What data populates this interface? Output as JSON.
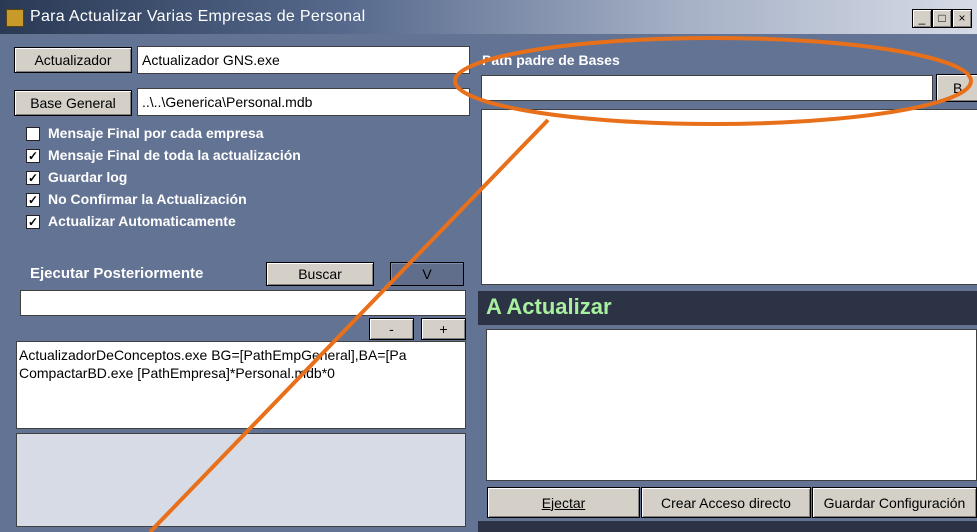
{
  "window": {
    "title": "Para Actualizar Varias Empresas de Personal",
    "buttons": {
      "minimize": "_",
      "maximize": "□",
      "close": "×"
    }
  },
  "left": {
    "actualizador_label": "Actualizador",
    "actualizador_value": "Actualizador GNS.exe",
    "base_general_label": "Base General",
    "base_general_value": "..\\..\\Generica\\Personal.mdb",
    "checkboxes": [
      {
        "label": "Mensaje Final por cada empresa",
        "checked": false,
        "mark": ""
      },
      {
        "label": "Mensaje Final de toda la actualización",
        "checked": true,
        "mark": "✓"
      },
      {
        "label": "Guardar log",
        "checked": true,
        "mark": "✓"
      },
      {
        "label": "No Confirmar la Actualización",
        "checked": true,
        "mark": "✓"
      },
      {
        "label": "Actualizar Automaticamente",
        "checked": true,
        "mark": "✓"
      }
    ],
    "ejecutar_label": "Ejecutar Posteriormente",
    "buscar_label": "Buscar",
    "v_label": "V",
    "ejecutar_value": "",
    "minus_label": "-",
    "plus_label": "+",
    "commands": [
      "ActualizadorDeConceptos.exe BG=[PathEmpGeneral],BA=[Pa",
      "CompactarBD.exe [PathEmpresa]*Personal.mdb*0"
    ]
  },
  "right": {
    "path_label": "Path padre de Bases",
    "path_value": "",
    "browse_label": "B",
    "panel_title": "A Actualizar",
    "buttons": {
      "ejecutar": "Ejectar",
      "crear_acceso": "Crear Acceso directo",
      "guardar": "Guardar Configuración"
    }
  },
  "colors": {
    "window_bg": "#637393",
    "panel_title": "#a8f0a0",
    "annotation": "#e8701a"
  }
}
